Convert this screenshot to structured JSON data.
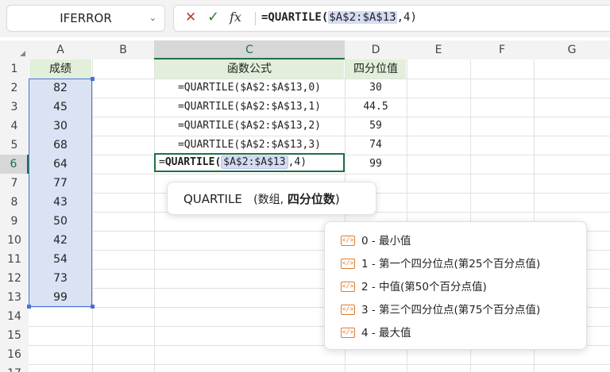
{
  "name_box": {
    "value": "IFERROR"
  },
  "formula_bar": {
    "fx": "fx",
    "prefix": "=QUARTILE(",
    "ref": "$A$2:$A$13",
    "suffix": ",4)"
  },
  "columns": [
    "A",
    "B",
    "C",
    "D",
    "E",
    "F",
    "G"
  ],
  "rows": [
    "1",
    "2",
    "3",
    "4",
    "5",
    "6",
    "7",
    "8",
    "9",
    "10",
    "11",
    "12",
    "13",
    "14",
    "15",
    "16",
    "17"
  ],
  "sheet": {
    "a_header": "成绩",
    "a_values": [
      "82",
      "45",
      "30",
      "68",
      "64",
      "77",
      "43",
      "50",
      "42",
      "54",
      "73",
      "99"
    ],
    "c_header": "函数公式",
    "d_header": "四分位值",
    "formulas": [
      "=QUARTILE($A$2:$A$13,0)",
      "=QUARTILE($A$2:$A$13,1)",
      "=QUARTILE($A$2:$A$13,2)",
      "=QUARTILE($A$2:$A$13,3)"
    ],
    "results": [
      "30",
      "44.5",
      "59",
      "74",
      "99"
    ],
    "editing": {
      "prefix": "=",
      "func": "QUARTILE(",
      "ref": "$A$2:$A$13",
      "suffix": ",4)"
    }
  },
  "tooltip": {
    "func": "QUARTILE",
    "arg1": "(数组,",
    "arg2": "四分位数",
    "close": ")"
  },
  "autocomplete": {
    "items": [
      "0 - 最小值",
      "1 - 第一个四分位点(第25个百分点值)",
      "2 - 中值(第50个百分点值)",
      "3 - 第三个四分位点(第75个百分点值)",
      "4 - 最大值"
    ]
  },
  "colors": {
    "accent": "#1e7145",
    "selection": "#4a6fd8",
    "header_fill": "#e2efda",
    "range_fill": "#dae3f3"
  }
}
